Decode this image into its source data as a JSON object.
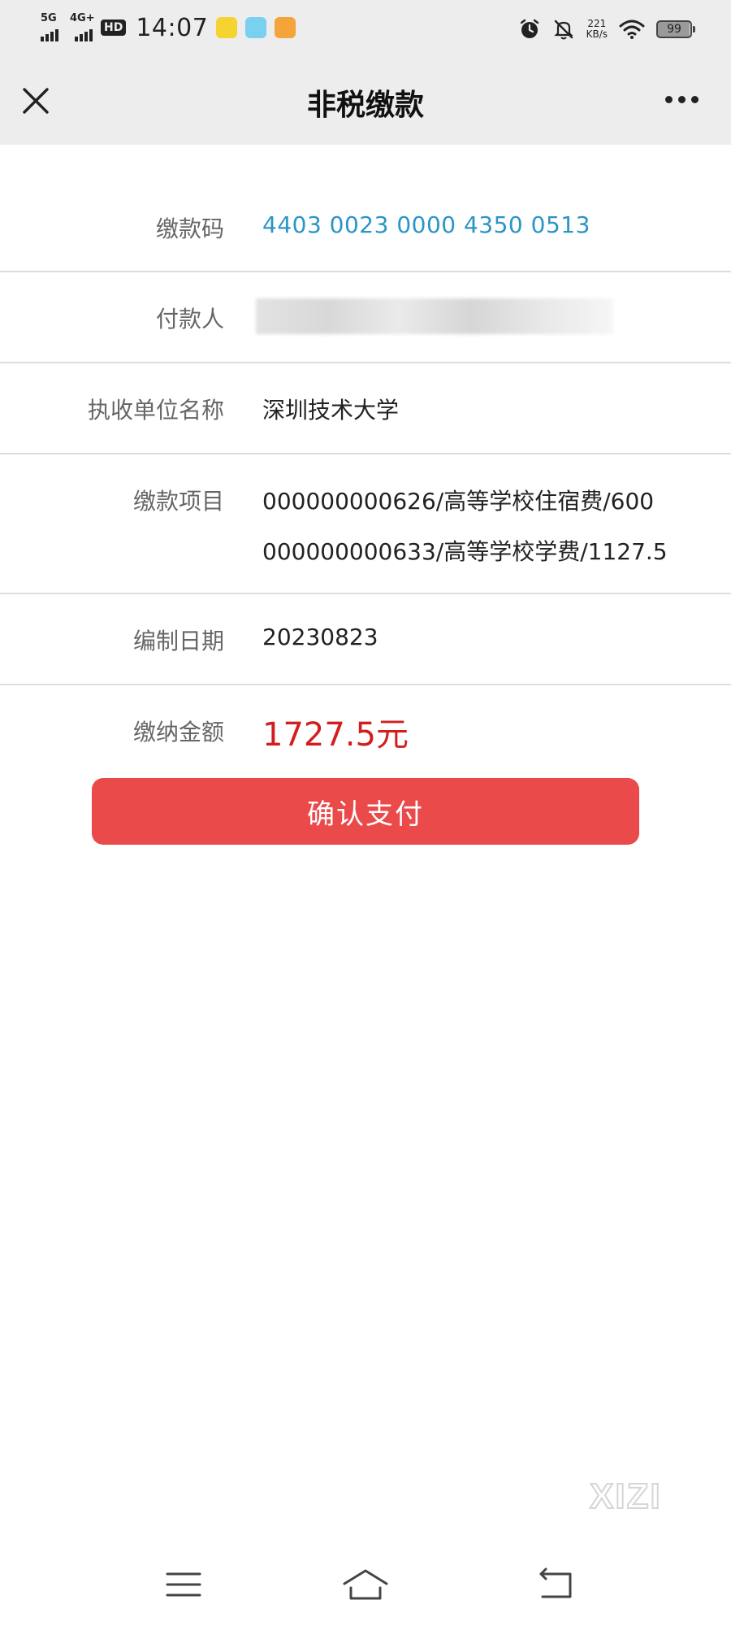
{
  "status_bar": {
    "signal1": "5G",
    "signal2": "4G+",
    "hd": "HD",
    "time": "14:07",
    "net_speed_value": "221",
    "net_speed_unit": "KB/s",
    "battery": "99",
    "icons": [
      "alarm-icon",
      "mute-icon",
      "wifi-icon"
    ]
  },
  "nav": {
    "title": "非税缴款"
  },
  "form": {
    "payment_code": {
      "label": "缴款码",
      "value": "4403 0023 0000 4350 0513"
    },
    "payer": {
      "label": "付款人"
    },
    "collecting_unit": {
      "label": "执收单位名称",
      "value": "深圳技术大学"
    },
    "items": {
      "label": "缴款项目",
      "lines": [
        "000000000626/高等学校住宿费/600",
        "000000000633/高等学校学费/1127.5"
      ]
    },
    "compile_date": {
      "label": "编制日期",
      "value": "20230823"
    },
    "amount": {
      "label": "缴纳金额",
      "value": "1727.5元"
    }
  },
  "confirm_button": "确认支付",
  "watermark": "XIZI",
  "colors": {
    "accent_blue": "#2a95c6",
    "amount_red": "#d21e1e",
    "button_red": "#ea4a4a",
    "bar_gray": "#ededed"
  }
}
